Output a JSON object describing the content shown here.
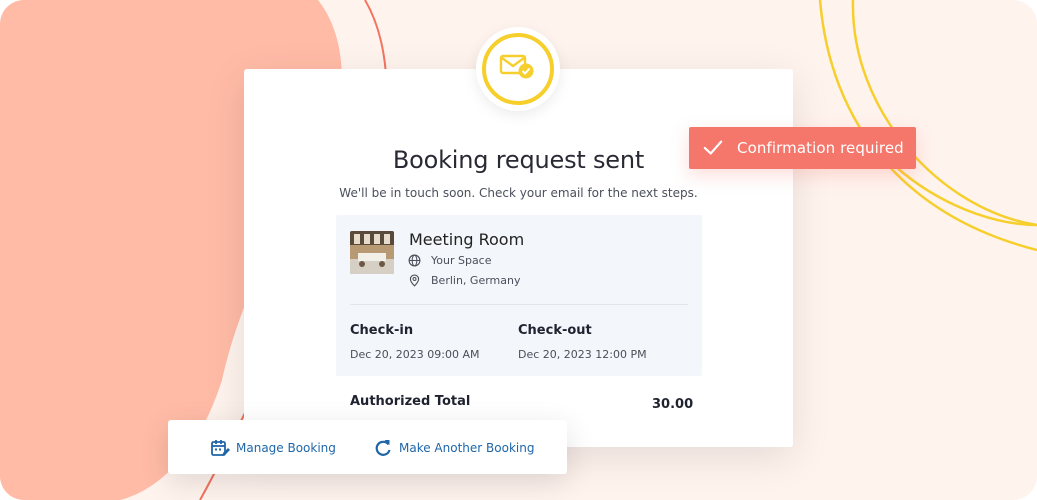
{
  "header": {
    "title": "Booking request sent",
    "subtitle": "We'll be in touch soon. Check your email for the next steps."
  },
  "badge": {
    "icon": "mail-check-icon"
  },
  "booking": {
    "room_name": "Meeting Room",
    "space": "Your Space",
    "location": "Berlin, Germany",
    "checkin_label": "Check-in",
    "checkin_value": "Dec 20, 2023 09:00 AM",
    "checkout_label": "Check-out",
    "checkout_value": "Dec 20, 2023 12:00 PM",
    "total_label": "Authorized Total",
    "total_value": "30.00"
  },
  "actions": {
    "manage_label": "Manage Booking",
    "another_label": "Make Another Booking"
  },
  "toast": {
    "text": "Confirmation required"
  },
  "colors": {
    "accent_yellow": "#f6cf2c",
    "toast_red": "#f5776b",
    "blob_salmon": "#ffbba6",
    "link_blue": "#1f66a8"
  }
}
